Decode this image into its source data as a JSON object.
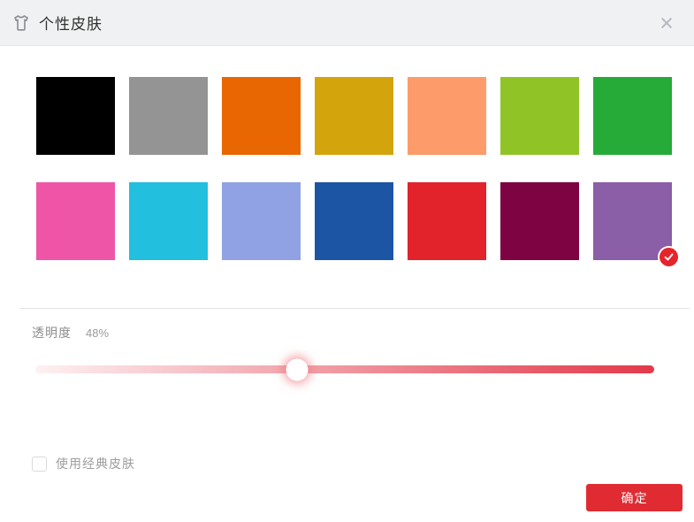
{
  "window": {
    "title": "个性皮肤"
  },
  "header": {
    "close_icon": "×"
  },
  "swatches": {
    "colors": [
      "#000000",
      "#949494",
      "#e96703",
      "#d4a40d",
      "#fd9b6b",
      "#90c426",
      "#26ab38",
      "#ef55a7",
      "#22bfdf",
      "#90a2e4",
      "#1c55a3",
      "#e2232c",
      "#7e0342",
      "#8b5ea8"
    ],
    "selected_index": 13,
    "check_badge_color": "#e5242c"
  },
  "transparency": {
    "label": "透明度",
    "value": "48%"
  },
  "slider": {
    "track_start_color": "#fdf1f2",
    "track_end_color": "#e2394a",
    "handle_percent": 42.3
  },
  "classic_skin": {
    "label": "使用经典皮肤",
    "checked": false
  },
  "footer": {
    "confirm_label": "确定"
  }
}
